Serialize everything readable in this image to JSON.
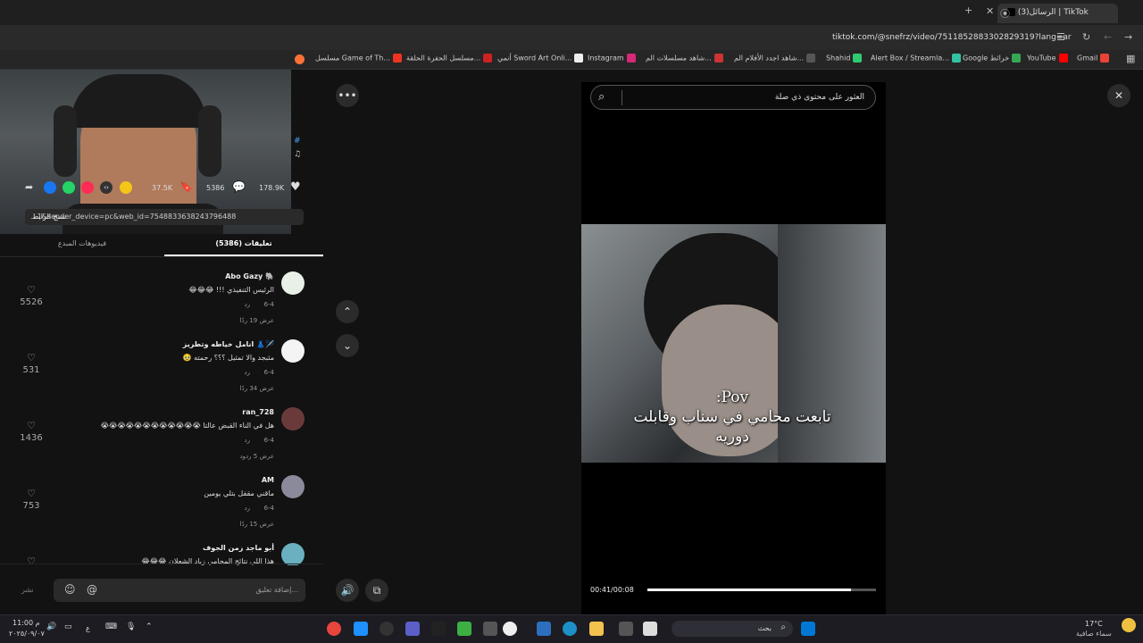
{
  "browser": {
    "tab_title": "(3)الرسائل | TikTok",
    "url": "tiktok.com/@snefrz/video/7511852883302829319?lang=ar",
    "bookmarks": [
      {
        "label": "Gmail",
        "color": "#ea4335"
      },
      {
        "label": "YouTube",
        "color": "#ff0000"
      },
      {
        "label": "Google خرائط",
        "color": "#34a853"
      },
      {
        "label": "Alert Box / Streamla...",
        "color": "#31c3a2"
      },
      {
        "label": "Shahid",
        "color": "#2ecc71"
      },
      {
        "label": "شاهد اجدد الأفلام الم...",
        "color": "#555555"
      },
      {
        "label": "شاهد مسلسلات الم...",
        "color": "#cc3333"
      },
      {
        "label": "Instagram",
        "color": "#d62976"
      },
      {
        "label": "أنمي Sword Art Onli...",
        "color": "#eeeeee"
      },
      {
        "label": "مسلسل الحفرة الحلقة...",
        "color": "#cc2222"
      },
      {
        "label": "مسلسل Game of Th...",
        "color": "#ee3322"
      }
    ]
  },
  "actions": {
    "likes": "178.9K",
    "comments": "5386",
    "saves": "37.5K"
  },
  "share": {
    "link": "...1&sender_device=pc&web_id=7548833638243796488",
    "copy_label": "نسخ الرابط"
  },
  "tabs": {
    "comments": "تعليقات (5386)",
    "creator_videos": "فيديوهات المبدع"
  },
  "comments": [
    {
      "user": "Abo Gazy 🐘",
      "text": "الرئيس التنفيذي !!! 😂😂😂",
      "date": "6-4",
      "reply": "رد",
      "replies": "عرض 19 ردًا",
      "likes": "5526",
      "avatar": "#e8f0e8"
    },
    {
      "user": "انامل خياطه وتطريز 👗🪡",
      "text": "مثبجد والا تمثيل ؟؟؟ رحمته 🥹",
      "date": "6-4",
      "reply": "رد",
      "replies": "عرض 34 ردًا",
      "likes": "531",
      "avatar": "#f4f4f4"
    },
    {
      "user": "ran_728",
      "text": "هل في الناء القبض عالتا 😭😭😭😭😭😭😭😭😭😭😭😭",
      "date": "6-4",
      "reply": "رد",
      "replies": "عرض 5 ردود",
      "likes": "1436",
      "avatar": "#6a3a3a"
    },
    {
      "user": "AM",
      "text": "ماقني مقفل بتلي يومين",
      "date": "6-4",
      "reply": "رد",
      "replies": "عرض 15 ردًا",
      "likes": "753",
      "avatar": "#8a8a9a"
    },
    {
      "user": "أبو ماجد زمن الجوف",
      "text": "هذا اللي نتائج المحامي زياد الشعلان 😂😂😂",
      "date": "",
      "reply": "",
      "replies": "",
      "likes": "",
      "avatar": "#6ab0c0"
    }
  ],
  "input": {
    "placeholder": "إضافة تعليق...",
    "post_label": "نشر"
  },
  "player": {
    "search_placeholder": "العثور على محتوى ذي صلة",
    "caption_line1": "Pov:",
    "caption_line2": "تابعت محامي في سناب وقابلت",
    "caption_line3": "دوريه",
    "time": "00:41/00:08",
    "progress": 0.89
  },
  "taskbar": {
    "weather_temp": "17°C",
    "weather_desc": "سماء صافية",
    "search_label": "بحث",
    "time": "11:00 م",
    "date": "٢٠٢٥/٠٩/٠٧",
    "lang": "ع"
  }
}
